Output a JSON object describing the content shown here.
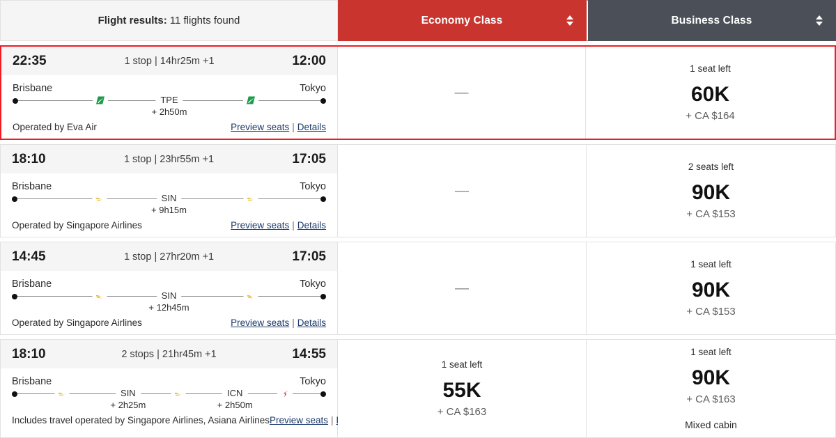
{
  "header": {
    "results_label": "Flight results:",
    "results_value": "11 flights found",
    "economy_label": "Economy Class",
    "business_label": "Business Class",
    "economy_color": "#c9342f",
    "business_color": "#4a4f58",
    "sort_icon": "sort-updown-icon"
  },
  "common": {
    "preview_seats": "Preview seats",
    "separator": "|",
    "details": "Details",
    "unavailable": "—",
    "origin": "Brisbane",
    "destination": "Tokyo"
  },
  "selection": {
    "highlight_color": "#ee1c25",
    "selected_row_index": 0
  },
  "rows": [
    {
      "depart_time": "22:35",
      "summary": "1 stop | 14hr25m +1",
      "arrive_time": "12:00",
      "origin": "Brisbane",
      "destination": "Tokyo",
      "stops": [
        {
          "code": "TPE",
          "layover": "+ 2h50m",
          "position": 50
        }
      ],
      "legs": [
        {
          "airline_icon": "eva-air-logo-icon",
          "color": "#1b9b4b",
          "position": 28
        },
        {
          "airline_icon": "eva-air-logo-icon",
          "color": "#1b9b4b",
          "position": 76
        }
      ],
      "operator": "Operated by Eva Air",
      "economy": {
        "available": false,
        "seats_left": "",
        "miles": "",
        "cash": "",
        "note": ""
      },
      "business": {
        "available": true,
        "seats_left": "1 seat left",
        "miles": "60K",
        "cash": "+ CA $164",
        "note": ""
      }
    },
    {
      "depart_time": "18:10",
      "summary": "1 stop | 23hr55m +1",
      "arrive_time": "17:05",
      "origin": "Brisbane",
      "destination": "Tokyo",
      "stops": [
        {
          "code": "SIN",
          "layover": "+ 9h15m",
          "position": 50
        }
      ],
      "legs": [
        {
          "airline_icon": "singapore-airlines-bird-icon",
          "color": "#e6b422",
          "position": 28
        },
        {
          "airline_icon": "singapore-airlines-bird-icon",
          "color": "#e6b422",
          "position": 76
        }
      ],
      "operator": "Operated by Singapore Airlines",
      "economy": {
        "available": false,
        "seats_left": "",
        "miles": "",
        "cash": "",
        "note": ""
      },
      "business": {
        "available": true,
        "seats_left": "2 seats left",
        "miles": "90K",
        "cash": "+ CA $153",
        "note": ""
      }
    },
    {
      "depart_time": "14:45",
      "summary": "1 stop | 27hr20m +1",
      "arrive_time": "17:05",
      "origin": "Brisbane",
      "destination": "Tokyo",
      "stops": [
        {
          "code": "SIN",
          "layover": "+ 12h45m",
          "position": 50
        }
      ],
      "legs": [
        {
          "airline_icon": "singapore-airlines-bird-icon",
          "color": "#e6b422",
          "position": 28
        },
        {
          "airline_icon": "singapore-airlines-bird-icon",
          "color": "#e6b422",
          "position": 76
        }
      ],
      "operator": "Operated by Singapore Airlines",
      "economy": {
        "available": false,
        "seats_left": "",
        "miles": "",
        "cash": "",
        "note": ""
      },
      "business": {
        "available": true,
        "seats_left": "1 seat left",
        "miles": "90K",
        "cash": "+ CA $153",
        "note": ""
      }
    },
    {
      "depart_time": "18:10",
      "summary": "2 stops | 21hr45m +1",
      "arrive_time": "14:55",
      "origin": "Brisbane",
      "destination": "Tokyo",
      "stops": [
        {
          "code": "SIN",
          "layover": "+ 2h25m",
          "position": 37
        },
        {
          "code": "ICN",
          "layover": "+ 2h50m",
          "position": 71
        }
      ],
      "legs": [
        {
          "airline_icon": "singapore-airlines-bird-icon",
          "color": "#e6b422",
          "position": 16
        },
        {
          "airline_icon": "singapore-airlines-bird-icon",
          "color": "#e6b422",
          "position": 53
        },
        {
          "airline_icon": "asiana-airlines-logo-icon",
          "color": "#e8112d",
          "position": 87
        }
      ],
      "operator": "Includes travel operated by Singapore Airlines, Asiana Airlines",
      "economy": {
        "available": true,
        "seats_left": "1 seat left",
        "miles": "55K",
        "cash": "+ CA $163",
        "note": ""
      },
      "business": {
        "available": true,
        "seats_left": "1 seat left",
        "miles": "90K",
        "cash": "+ CA $163",
        "note": "Mixed cabin"
      }
    }
  ]
}
